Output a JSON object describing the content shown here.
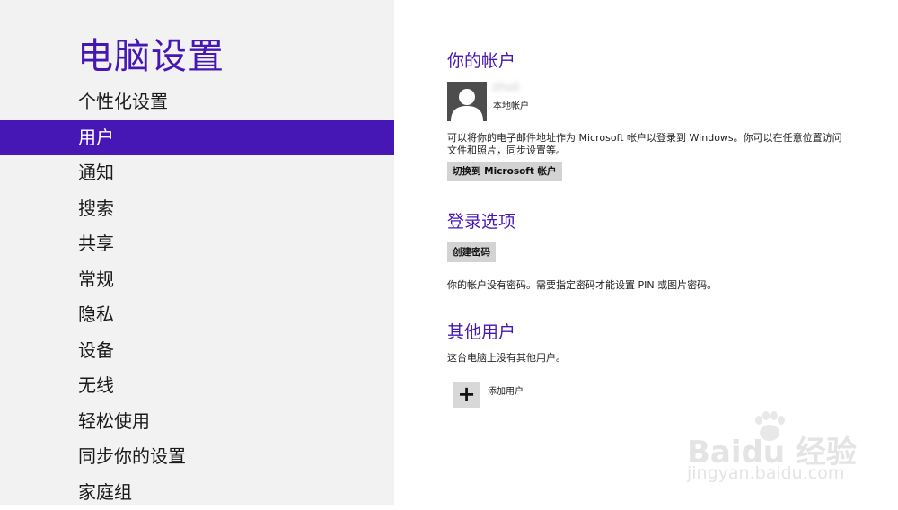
{
  "app_title": "电脑设置",
  "nav": {
    "items": [
      {
        "label": "个性化设置"
      },
      {
        "label": "用户"
      },
      {
        "label": "通知"
      },
      {
        "label": "搜索"
      },
      {
        "label": "共享"
      },
      {
        "label": "常规"
      },
      {
        "label": "隐私"
      },
      {
        "label": "设备"
      },
      {
        "label": "无线"
      },
      {
        "label": "轻松使用"
      },
      {
        "label": "同步你的设置"
      },
      {
        "label": "家庭组"
      }
    ],
    "selected": "用户"
  },
  "account": {
    "heading": "你的帐户",
    "name": "zhuli",
    "type": "本地帐户",
    "description": "可以将你的电子邮件地址作为 Microsoft 帐户以登录到 Windows。你可以在任意位置访问文件和照片，同步设置等。",
    "switch_button": "切换到 Microsoft 帐户"
  },
  "signin": {
    "heading": "登录选项",
    "create_password_button": "创建密码",
    "description": "你的帐户没有密码。需要指定密码才能设置 PIN 或图片密码。"
  },
  "other_users": {
    "heading": "其他用户",
    "description": "这台电脑上没有其他用户。",
    "add_user_label": "添加用户"
  },
  "watermark": {
    "logo": "Baidu 经验",
    "site": "jingyan.baidu.com"
  },
  "colors": {
    "accent": "#4617b4",
    "sidebar_bg": "#f2f2f2",
    "button_bg": "#d3d3d3"
  }
}
